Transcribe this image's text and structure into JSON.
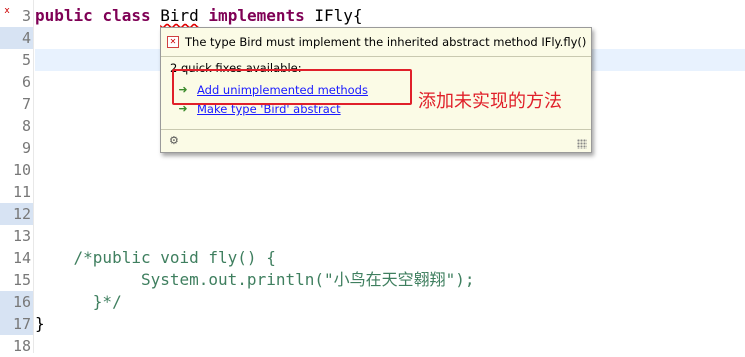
{
  "editor": {
    "line_numbers": [
      "3",
      "4",
      "5",
      "6",
      "7",
      "8",
      "9",
      "10",
      "11",
      "12",
      "13",
      "14",
      "15",
      "16",
      "17",
      "18"
    ],
    "highlighted_gutter_lines": [
      "4",
      "12",
      "16",
      "17"
    ],
    "error_marker": "x",
    "line3": {
      "kw1": "public",
      "kw2": "class",
      "class_name": "Bird",
      "kw3": "implements",
      "iface": "IFly{"
    },
    "line14": "/*public void fly() {",
    "line15_pre": "System.out.println(",
    "line15_str": "\"小鸟在天空翱翔\"",
    "line15_post": ");",
    "line16": "}*/",
    "line17": "}"
  },
  "quickfix": {
    "title": "The type Bird must implement the inherited abstract method IFly.fly()",
    "count": "2 quick fixes available:",
    "fixes": [
      "Add unimplemented methods",
      "Make type 'Bird' abstract"
    ]
  },
  "annotation": {
    "text": "添加未实现的方法",
    "color": "#e0202a"
  }
}
